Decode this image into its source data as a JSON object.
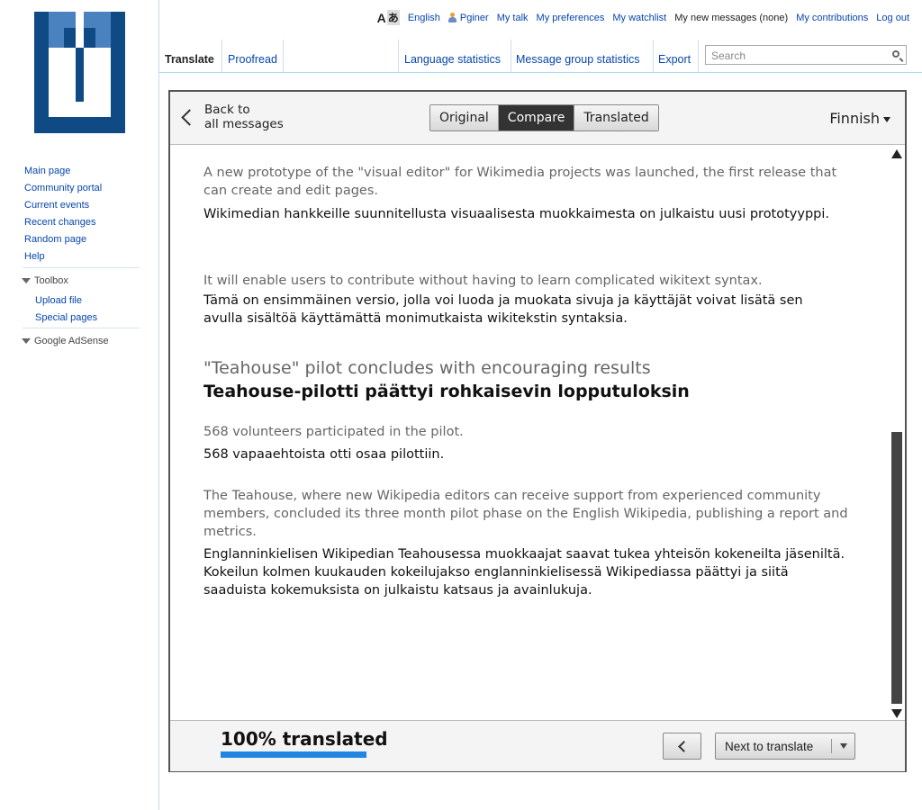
{
  "sidebar": {
    "logo_alt": "translatewiki logo",
    "nav": [
      "Main page",
      "Community portal",
      "Current events",
      "Recent changes",
      "Random page",
      "Help"
    ],
    "toolbox_label": "Toolbox",
    "toolbox_items": [
      "Upload file",
      "Special pages"
    ],
    "adsense_label": "Google AdSense"
  },
  "personal": {
    "language": "English",
    "username": "Pginer",
    "talk": "My talk",
    "preferences": "My preferences",
    "watchlist": "My watchlist",
    "messages": "My new messages (none)",
    "contributions": "My contributions",
    "logout": "Log out"
  },
  "tabs": {
    "translate": "Translate",
    "proofread": "Proofread",
    "language_statistics": "Language statistics",
    "message_group_statistics": "Message group statistics",
    "export": "Export"
  },
  "search": {
    "placeholder": "Search"
  },
  "panel": {
    "back_line1": "Back to",
    "back_line2": "all messages",
    "view_original": "Original",
    "view_compare": "Compare",
    "view_translated": "Translated",
    "active_view": "Compare",
    "language": "Finnish"
  },
  "messages": [
    {
      "source": "A new prototype of the \"visual editor\" for Wikimedia projects was launched, the first release that can create and edit pages.",
      "translation": "Wikimedian hankkeille suunnitellusta visuaalisesta muokkaimesta on julkaistu uusi prototyyppi."
    },
    {
      "source": "It will enable users to contribute without having to learn complicated wikitext syntax.",
      "translation": "Tämä on ensimmäinen versio, jolla voi luoda ja muokata sivuja ja käyttäjät voivat lisätä sen avulla sisältöä käyttämättä monimutkaista wikitekstin syntaksia."
    },
    {
      "source": "\"Teahouse\" pilot concludes with encouraging results",
      "translation": "Teahouse-pilotti päättyi rohkaisevin lopputuloksin"
    },
    {
      "source": "568 volunteers participated in the pilot.",
      "translation": "568 vapaaehtoista otti osaa pilottiin."
    },
    {
      "source": "The Teahouse, where new Wikipedia editors can receive support from experienced community members, concluded its three month pilot phase on the English Wikipedia, publishing a report and metrics.",
      "translation": "Englanninkielisen Wikipedian Teahousessa muokkaajat saavat tukea yhteisön kokeneilta jäseniltä. Kokeilun kolmen kuukauden kokeilujakso englanninkielisessä Wikipediassa päättyi ja siitä saaduista kokemuksista on julkaistu katsaus ja avainlukuja."
    }
  ],
  "footer": {
    "progress_label": "100% translated",
    "progress_fraction": 1.0,
    "next_label": "Next to translate"
  },
  "colors": {
    "link": "#0645ad",
    "progress": "#2186e2",
    "logo_dark": "#0f4a85",
    "logo_light": "#4a82c0"
  }
}
